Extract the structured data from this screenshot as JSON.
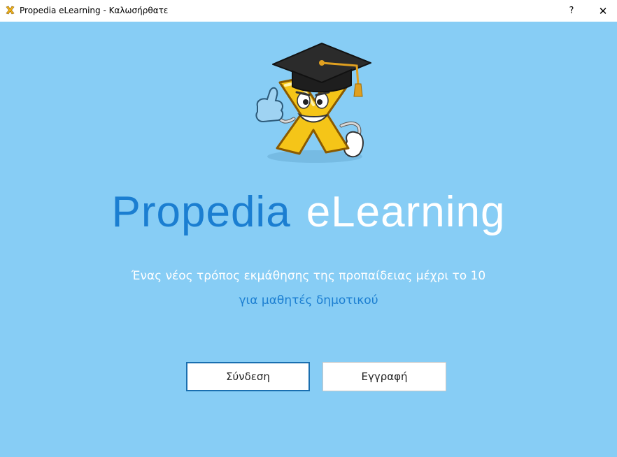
{
  "window": {
    "title": "Propedia eLearning - Καλωσήρθατε",
    "help_label": "?",
    "close_label": "✕"
  },
  "icons": {
    "app": "app-icon",
    "mascot": "graduation-x-mascot-icon"
  },
  "main": {
    "title_part_1": "Propedia",
    "title_part_2": "eLearning",
    "tagline_line_1": "Ένας νέος τρόπος εκμάθησης της προπαίδειας μέχρι το 10",
    "tagline_line_2": "για μαθητές δημοτικού"
  },
  "actions": {
    "login_label": "Σύνδεση",
    "register_label": "Εγγραφή"
  },
  "colors": {
    "background": "#87cdf5",
    "accent_blue": "#1b7ed1",
    "white": "#ffffff"
  }
}
